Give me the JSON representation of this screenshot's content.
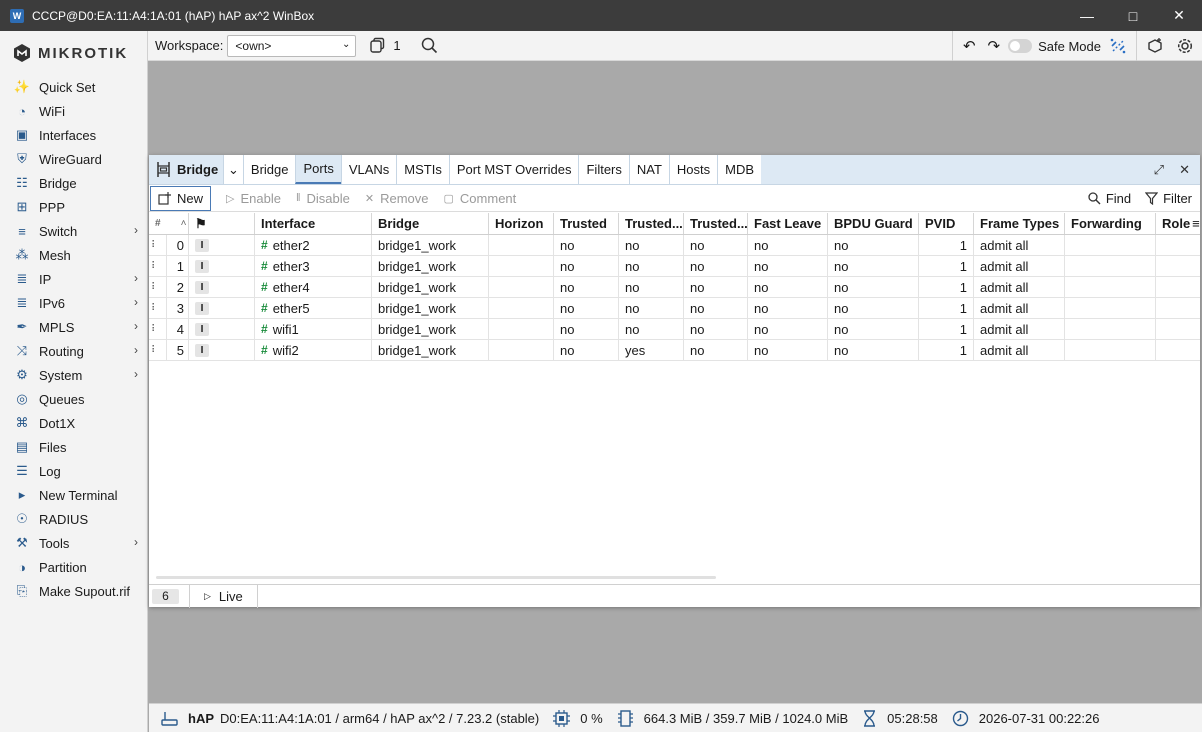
{
  "titlebar": {
    "title": "CCCP@D0:EA:11:A4:1A:01 (hAP) hAP ax^2 WinBox"
  },
  "brand": {
    "logo_text": "MIKROTIK"
  },
  "sidebar": {
    "items": [
      {
        "label": "Quick Set",
        "icon": "wand-icon"
      },
      {
        "label": "WiFi",
        "icon": "wifi-icon"
      },
      {
        "label": "Interfaces",
        "icon": "interfaces-icon"
      },
      {
        "label": "WireGuard",
        "icon": "wireguard-icon"
      },
      {
        "label": "Bridge",
        "icon": "bridge-icon"
      },
      {
        "label": "PPP",
        "icon": "ppp-icon"
      },
      {
        "label": "Switch",
        "icon": "switch-icon",
        "submenu": true
      },
      {
        "label": "Mesh",
        "icon": "mesh-icon"
      },
      {
        "label": "IP",
        "icon": "ip-icon",
        "submenu": true
      },
      {
        "label": "IPv6",
        "icon": "ipv6-icon",
        "submenu": true
      },
      {
        "label": "MPLS",
        "icon": "mpls-icon",
        "submenu": true
      },
      {
        "label": "Routing",
        "icon": "routing-icon",
        "submenu": true
      },
      {
        "label": "System",
        "icon": "gear-icon",
        "submenu": true
      },
      {
        "label": "Queues",
        "icon": "queues-icon"
      },
      {
        "label": "Dot1X",
        "icon": "dot1x-icon"
      },
      {
        "label": "Files",
        "icon": "folder-icon"
      },
      {
        "label": "Log",
        "icon": "log-icon"
      },
      {
        "label": "New Terminal",
        "icon": "terminal-icon"
      },
      {
        "label": "RADIUS",
        "icon": "radius-icon"
      },
      {
        "label": "Tools",
        "icon": "tools-icon",
        "submenu": true
      },
      {
        "label": "Partition",
        "icon": "partition-icon"
      },
      {
        "label": "Make Supout.rif",
        "icon": "supout-icon"
      }
    ]
  },
  "topbar": {
    "workspace_label": "Workspace:",
    "workspace_value": "<own>",
    "window_count": "1",
    "safe_mode_label": "Safe Mode"
  },
  "window": {
    "title": "Bridge",
    "tabs": [
      "Bridge",
      "Ports",
      "VLANs",
      "MSTIs",
      "Port MST Overrides",
      "Filters",
      "NAT",
      "Hosts",
      "MDB"
    ],
    "active_tab": "Ports",
    "actions": {
      "new": "New",
      "enable": "Enable",
      "disable": "Disable",
      "remove": "Remove",
      "comment": "Comment",
      "find": "Find",
      "filter": "Filter"
    },
    "columns": {
      "num": "#",
      "interface": "Interface",
      "bridge": "Bridge",
      "horizon": "Horizon",
      "trusted": "Trusted",
      "trusted2": "Trusted...",
      "trusted3": "Trusted...",
      "fast_leave": "Fast Leave",
      "bpdu_guard": "BPDU Guard",
      "pvid": "PVID",
      "frame_types": "Frame Types",
      "forwarding": "Forwarding",
      "role": "Role"
    },
    "rows": [
      {
        "num": "0",
        "flag": "I",
        "interface": "ether2",
        "bridge": "bridge1_work",
        "horizon": "",
        "trusted": "no",
        "trusted2": "no",
        "trusted3": "no",
        "fast_leave": "no",
        "bpdu_guard": "no",
        "pvid": "1",
        "frame_types": "admit all",
        "forwarding": "",
        "role": ""
      },
      {
        "num": "1",
        "flag": "I",
        "interface": "ether3",
        "bridge": "bridge1_work",
        "horizon": "",
        "trusted": "no",
        "trusted2": "no",
        "trusted3": "no",
        "fast_leave": "no",
        "bpdu_guard": "no",
        "pvid": "1",
        "frame_types": "admit all",
        "forwarding": "",
        "role": ""
      },
      {
        "num": "2",
        "flag": "I",
        "interface": "ether4",
        "bridge": "bridge1_work",
        "horizon": "",
        "trusted": "no",
        "trusted2": "no",
        "trusted3": "no",
        "fast_leave": "no",
        "bpdu_guard": "no",
        "pvid": "1",
        "frame_types": "admit all",
        "forwarding": "",
        "role": ""
      },
      {
        "num": "3",
        "flag": "I",
        "interface": "ether5",
        "bridge": "bridge1_work",
        "horizon": "",
        "trusted": "no",
        "trusted2": "no",
        "trusted3": "no",
        "fast_leave": "no",
        "bpdu_guard": "no",
        "pvid": "1",
        "frame_types": "admit all",
        "forwarding": "",
        "role": ""
      },
      {
        "num": "4",
        "flag": "I",
        "interface": "wifi1",
        "bridge": "bridge1_work",
        "horizon": "",
        "trusted": "no",
        "trusted2": "no",
        "trusted3": "no",
        "fast_leave": "no",
        "bpdu_guard": "no",
        "pvid": "1",
        "frame_types": "admit all",
        "forwarding": "",
        "role": ""
      },
      {
        "num": "5",
        "flag": "I",
        "interface": "wifi2",
        "bridge": "bridge1_work",
        "horizon": "",
        "trusted": "no",
        "trusted2": "yes",
        "trusted3": "no",
        "fast_leave": "no",
        "bpdu_guard": "no",
        "pvid": "1",
        "frame_types": "admit all",
        "forwarding": "",
        "role": ""
      }
    ],
    "status": {
      "count": "6",
      "live_label": "Live"
    }
  },
  "bottombar": {
    "board": "hAP",
    "device_info": "D0:EA:11:A4:1A:01 / arm64 / hAP ax^2 / 7.23.2 (stable)",
    "cpu": "0 %",
    "memory": "664.3 MiB / 359.7 MiB / 1024.0 MiB",
    "uptime": "05:28:58",
    "datetime": "2026-07-31 00:22:26"
  },
  "colors": {
    "accent": "#4a7ab5",
    "tab_bg": "#dde9f4",
    "interface_icon": "#1a8c3c"
  }
}
